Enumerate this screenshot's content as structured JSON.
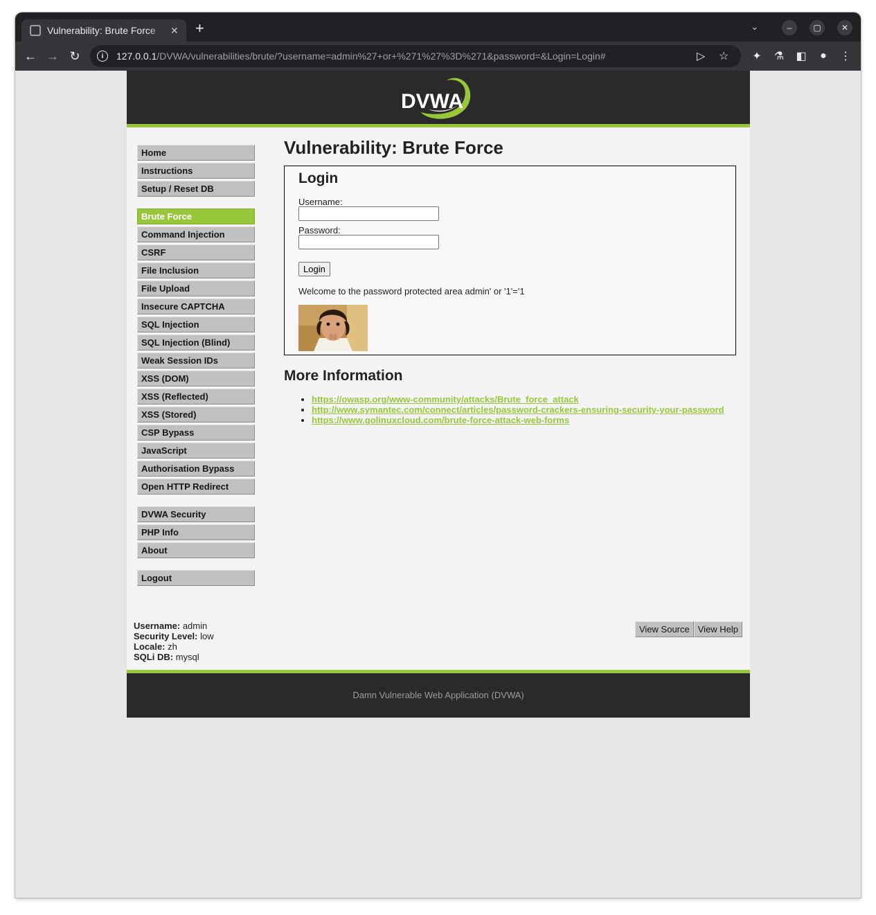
{
  "browser": {
    "tab_title": "Vulnerability: Brute Force",
    "new_tab_symbol": "+",
    "url_host": "127.0.0.1",
    "url_path": "/DVWA/vulnerabilities/brute/?username=admin%27+or+%271%27%3D%271&password=&Login=Login#"
  },
  "header": {
    "logo_text": "DVWA",
    "accent_color": "#98c73b"
  },
  "sidebar": {
    "group1": [
      "Home",
      "Instructions",
      "Setup / Reset DB"
    ],
    "group2": [
      "Brute Force",
      "Command Injection",
      "CSRF",
      "File Inclusion",
      "File Upload",
      "Insecure CAPTCHA",
      "SQL Injection",
      "SQL Injection (Blind)",
      "Weak Session IDs",
      "XSS (DOM)",
      "XSS (Reflected)",
      "XSS (Stored)",
      "CSP Bypass",
      "JavaScript",
      "Authorisation Bypass",
      "Open HTTP Redirect"
    ],
    "group3": [
      "DVWA Security",
      "PHP Info",
      "About"
    ],
    "group4": [
      "Logout"
    ],
    "selected": "Brute Force"
  },
  "main": {
    "page_title": "Vulnerability: Brute Force",
    "login_heading": "Login",
    "username_label": "Username:",
    "password_label": "Password:",
    "username_value": "",
    "password_value": "",
    "login_button": "Login",
    "welcome_text": "Welcome to the password protected area admin' or '1'='1",
    "more_info_heading": "More Information",
    "links": [
      "https://owasp.org/www-community/attacks/Brute_force_attack",
      "http://www.symantec.com/connect/articles/password-crackers-ensuring-security-your-password",
      "https://www.golinuxcloud.com/brute-force-attack-web-forms"
    ]
  },
  "status": {
    "username_label": "Username:",
    "username_value": "admin",
    "security_label": "Security Level:",
    "security_value": "low",
    "locale_label": "Locale:",
    "locale_value": "zh",
    "sqli_label": "SQLi DB:",
    "sqli_value": "mysql"
  },
  "buttons": {
    "view_source": "View Source",
    "view_help": "View Help"
  },
  "footer": {
    "text": "Damn Vulnerable Web Application (DVWA)"
  }
}
